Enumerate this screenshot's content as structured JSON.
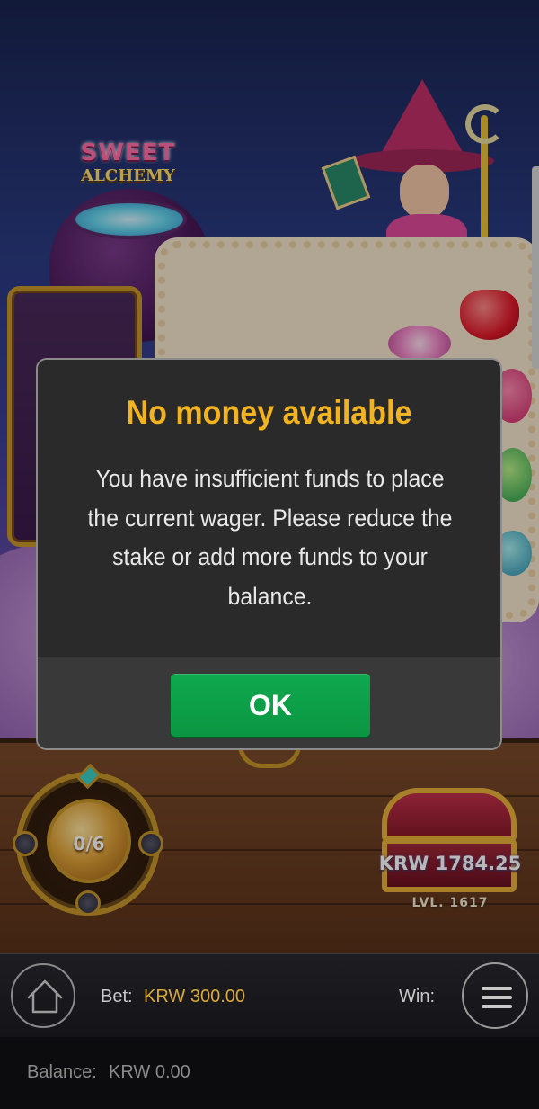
{
  "game": {
    "logo_line1": "SWEET",
    "logo_line2": "ALCHEMY",
    "collect_meter": "0/6",
    "collect_progress": 0,
    "chest_amount": "KRW 1784.25",
    "chest_level": "LVL. 1617"
  },
  "dialog": {
    "title": "No money available",
    "message": "You have insufficient funds to place the current wager. Please reduce the stake or add more funds to your balance.",
    "ok_label": "OK"
  },
  "bottom_bar": {
    "bet_label": "Bet:",
    "bet_value": "KRW 300.00",
    "win_label": "Win:",
    "balance_label": "Balance:",
    "balance_value": "KRW 0.00"
  },
  "icons": {
    "home": "home-icon",
    "menu": "hamburger-menu-icon"
  },
  "colors": {
    "title_accent": "#f2b320",
    "ok_button": "#0fa94e",
    "bet_value": "#d8a838"
  }
}
